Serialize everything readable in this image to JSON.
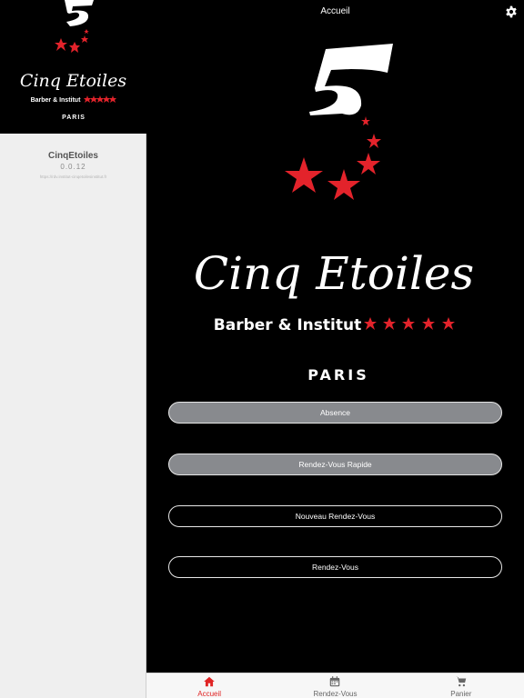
{
  "brand": {
    "name": "Cinq Etoiles",
    "subtitle": "Barber & Institut",
    "city": "PARIS",
    "star_color": "#e3232b"
  },
  "sidebar": {
    "app_name": "CinqEtoiles",
    "version": "0.0.12",
    "url": "https://rdv.institut-cinqetoilesinstitut.fr"
  },
  "header": {
    "title": "Accueil",
    "settings_icon": "gear-icon"
  },
  "buttons": [
    {
      "label": "Absence",
      "style": "filled"
    },
    {
      "label": "Rendez-Vous Rapide",
      "style": "filled"
    },
    {
      "label": "Nouveau Rendez-Vous",
      "style": "outline"
    },
    {
      "label": "Rendez-Vous",
      "style": "outline"
    }
  ],
  "tabs": [
    {
      "label": "Accueil",
      "icon": "home-icon",
      "active": true
    },
    {
      "label": "Rendez-Vous",
      "icon": "calendar-icon",
      "active": false
    },
    {
      "label": "Panier",
      "icon": "cart-icon",
      "active": false
    }
  ],
  "colors": {
    "accent": "#e02424",
    "button_filled": "#888a8e",
    "background": "#000000",
    "sidebar": "#efefef"
  }
}
